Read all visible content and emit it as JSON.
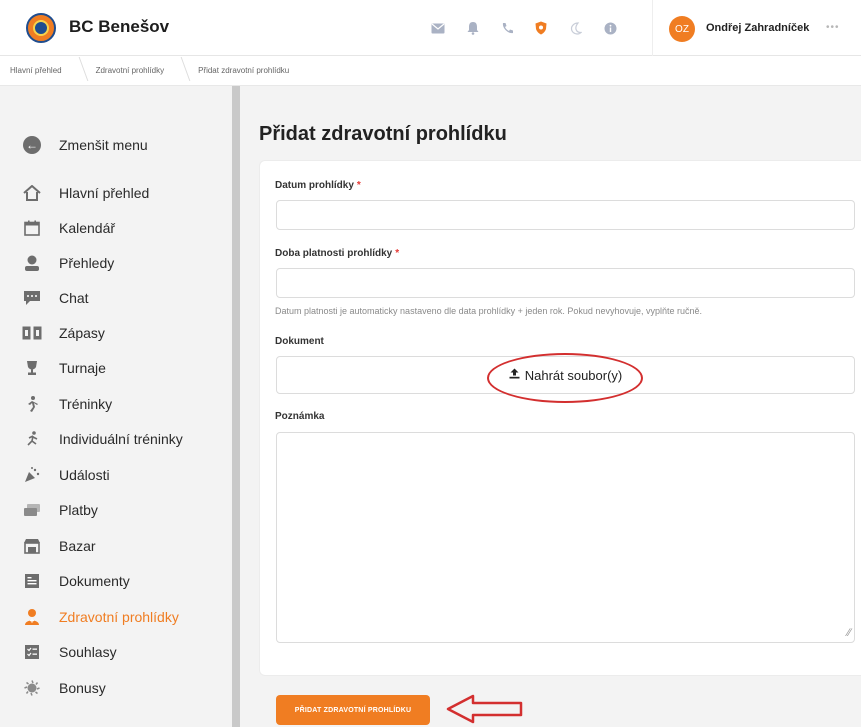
{
  "header": {
    "brand": "BC Benešov",
    "user_initials": "OZ",
    "user_name": "Ondřej Zahradníček",
    "icons": [
      "mail-icon",
      "bell-icon",
      "phone-icon",
      "shield-icon",
      "moon-icon",
      "info-icon"
    ],
    "more": "•••",
    "accent_color": "#f07d22"
  },
  "breadcrumb": [
    "Hlavní přehled",
    "Zdravotní prohlídky",
    "Přidat zdravotní prohlídku"
  ],
  "sidebar": {
    "collapse_label": "Zmenšit menu",
    "items": [
      {
        "label": "Hlavní přehled",
        "icon": "home-icon"
      },
      {
        "label": "Kalendář",
        "icon": "calendar-icon"
      },
      {
        "label": "Přehledy",
        "icon": "overview-icon"
      },
      {
        "label": "Chat",
        "icon": "chat-icon"
      },
      {
        "label": "Zápasy",
        "icon": "matches-icon"
      },
      {
        "label": "Turnaje",
        "icon": "trophy-icon"
      },
      {
        "label": "Tréninky",
        "icon": "training-icon"
      },
      {
        "label": "Individuální tréninky",
        "icon": "individual-training-icon"
      },
      {
        "label": "Události",
        "icon": "events-icon"
      },
      {
        "label": "Platby",
        "icon": "payments-icon"
      },
      {
        "label": "Bazar",
        "icon": "shop-icon"
      },
      {
        "label": "Dokumenty",
        "icon": "documents-icon"
      },
      {
        "label": "Zdravotní prohlídky",
        "icon": "medical-icon",
        "active": true
      },
      {
        "label": "Souhlasy",
        "icon": "consents-icon"
      },
      {
        "label": "Bonusy",
        "icon": "bonus-icon"
      }
    ]
  },
  "form": {
    "title": "Přidat zdravotní prohlídku",
    "date_label": "Datum prohlídky",
    "validity_label": "Doba platnosti prohlídky",
    "required_mark": "*",
    "validity_hint": "Datum platnosti je automaticky nastaveno dle data prohlídky + jeden rok. Pokud nevyhovuje, vyplňte ručně.",
    "document_label": "Dokument",
    "upload_label": "Nahrát soubor(y)",
    "note_label": "Poznámka",
    "submit_label": "PŘIDAT ZDRAVOTNÍ PROHLÍDKU"
  }
}
